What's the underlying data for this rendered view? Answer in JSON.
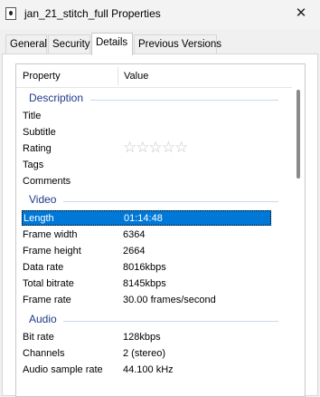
{
  "window": {
    "title": "jan_21_stitch_full Properties",
    "close_glyph": "✕"
  },
  "tabs": [
    {
      "label": "General"
    },
    {
      "label": "Security"
    },
    {
      "label": "Details",
      "active": true
    },
    {
      "label": "Previous Versions"
    }
  ],
  "columns": {
    "property": "Property",
    "value": "Value"
  },
  "groups": {
    "description": "Description",
    "video": "Video",
    "audio": "Audio"
  },
  "description": {
    "title": "Title",
    "subtitle": "Subtitle",
    "rating": "Rating",
    "rating_stars": "☆☆☆☆☆",
    "rating_value": 0,
    "tags": "Tags",
    "comments": "Comments"
  },
  "video": [
    {
      "label": "Length",
      "value": "01:14:48",
      "selected": true
    },
    {
      "label": "Frame width",
      "value": "6364"
    },
    {
      "label": "Frame height",
      "value": "2664"
    },
    {
      "label": "Data rate",
      "value": "8016kbps"
    },
    {
      "label": "Total bitrate",
      "value": "8145kbps"
    },
    {
      "label": "Frame rate",
      "value": "30.00 frames/second"
    }
  ],
  "audio": [
    {
      "label": "Bit rate",
      "value": "128kbps"
    },
    {
      "label": "Channels",
      "value": "2 (stereo)"
    },
    {
      "label": "Audio sample rate",
      "value": "44.100 kHz"
    }
  ],
  "colors": {
    "selection": "#0078d7",
    "group_heading": "#1e3a8a"
  }
}
